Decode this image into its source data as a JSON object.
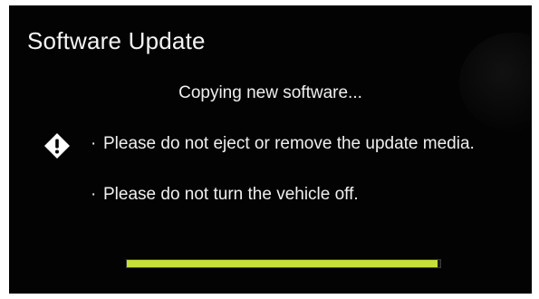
{
  "screen": {
    "title": "Software Update",
    "status": "Copying new software...",
    "messages": [
      {
        "bullet": "·",
        "text": "Please do not eject or remove the update media."
      },
      {
        "bullet": "·",
        "text": "Please do not turn the vehicle off."
      }
    ],
    "warning_icon": "warning-diamond-icon",
    "progress": {
      "value": 0.99,
      "color": "#c6df3a"
    }
  }
}
